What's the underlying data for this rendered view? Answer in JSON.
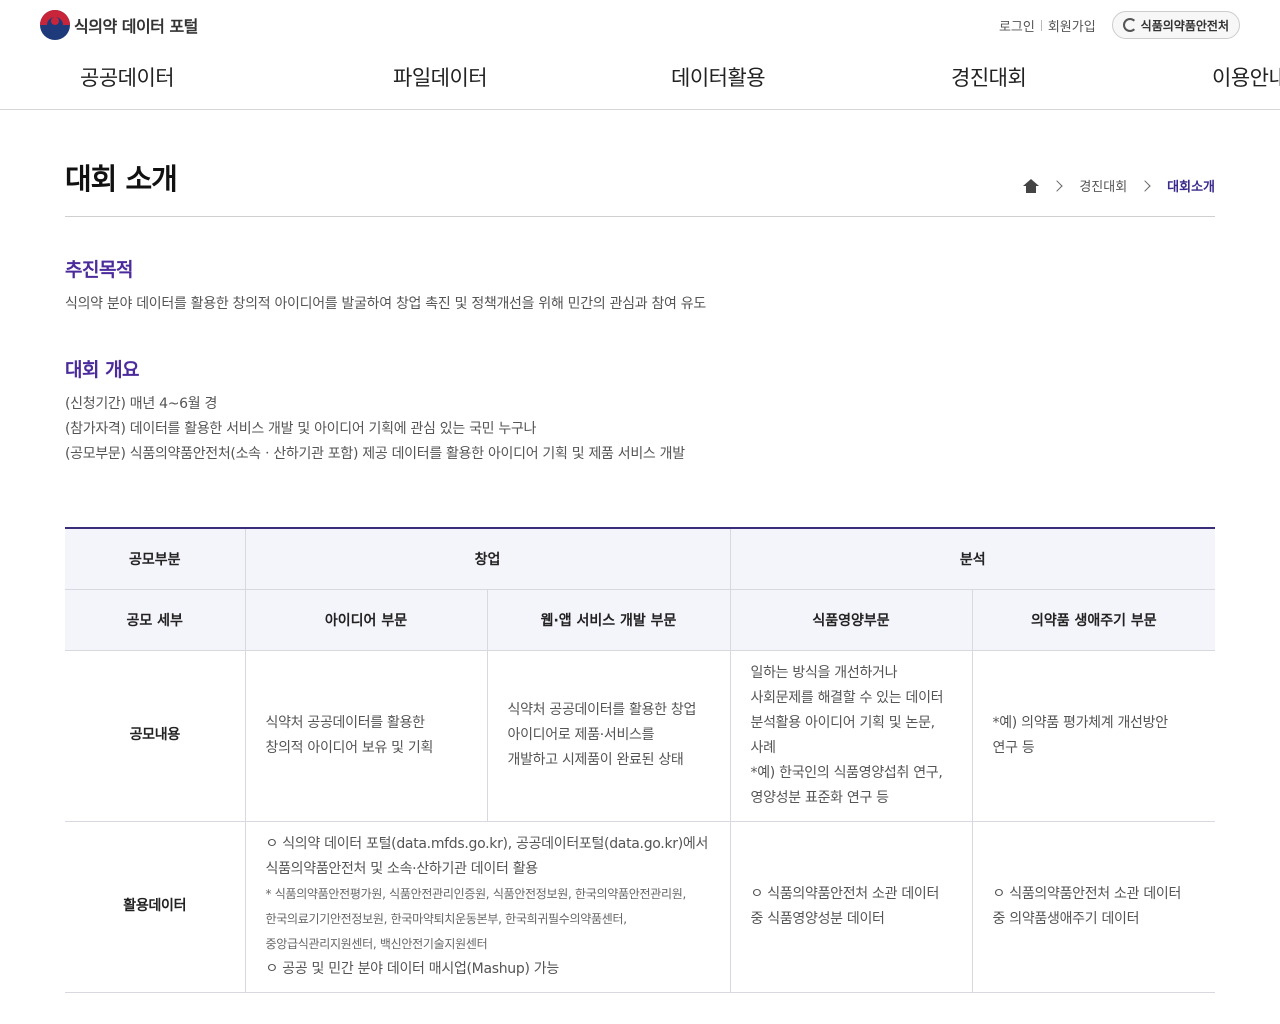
{
  "header": {
    "logo_text": "식의약 데이터 포털",
    "login": "로그인",
    "signup": "회원가입",
    "mfds_button": "식품의약품안전처"
  },
  "gnb": [
    "공공데이터",
    "파일데이터",
    "데이터활용",
    "경진대회",
    "이용안내"
  ],
  "page": {
    "title": "대회 소개",
    "breadcrumb": [
      "경진대회",
      "대회소개"
    ]
  },
  "purpose": {
    "heading": "추진목적",
    "text": "식의약 분야 데이터를 활용한 창의적 아이디어를 발굴하여 창업 촉진 및 정책개선을 위해 민간의 관심과 참여 유도"
  },
  "overview": {
    "heading": "대회 개요",
    "lines": [
      "(신청기간) 매년 4~6월 경",
      "(참가자격) 데이터를 활용한 서비스 개발 및 아이디어 기획에 관심 있는 국민 누구나",
      "(공모부문) 식품의약품안전처(소속ㆍ산하기관 포함) 제공 데이터를 활용한 아이디어 기획 및 제품 서비스 개발"
    ]
  },
  "table": {
    "h_category": "공모부분",
    "h_startup": "창업",
    "h_analysis": "분석",
    "h_detail": "공모 세부",
    "cols": [
      "아이디어 부문",
      "웹·앱 서비스 개발 부문",
      "식품영양부문",
      "의약품 생애주기 부문"
    ],
    "row_content_label": "공모내용",
    "content": [
      [
        "식약처 공공데이터를 활용한",
        "창의적 아이디어 보유 및 기획"
      ],
      [
        "식약처 공공데이터를 활용한 창업",
        "아이디어로 제품·서비스를",
        "개발하고 시제품이 완료된 상태"
      ],
      [
        "일하는 방식을 개선하거나",
        "사회문제를 해결할 수 있는 데이터",
        "분석활용 아이디어 기획 및 논문,",
        "사례",
        "*예) 한국인의 식품영양섭취 연구,",
        "영양성분 표준화 연구 등"
      ],
      [
        "*예) 의약품 평가체계 개선방안",
        "연구 등"
      ]
    ],
    "row_data_label": "활용데이터",
    "data_startup": {
      "line1": "ㅇ 식의약 데이터 포털(data.mfds.go.kr), 공공데이터포털(data.go.kr)에서",
      "line2": "식품의약품안전처 및 소속·산하기관 데이터 활용",
      "note1": "* 식품의약품안전평가원, 식품안전관리인증원, 식품안전정보원, 한국의약품안전관리원,",
      "note2": "한국의료기기안전정보원, 한국마약퇴치운동본부, 한국희귀필수의약품센터,",
      "note3": "중앙급식관리지원센터, 백신안전기술지원센터",
      "line3": "ㅇ 공공 및 민간 분야 데이터 매시업(Mashup) 가능"
    },
    "data_food": [
      "ㅇ 식품의약품안전처 소관 데이터",
      "중 식품영양성분 데이터"
    ],
    "data_drug": [
      "ㅇ 식품의약품안전처 소관 데이터",
      "중 의약품생애주기 데이터"
    ]
  }
}
